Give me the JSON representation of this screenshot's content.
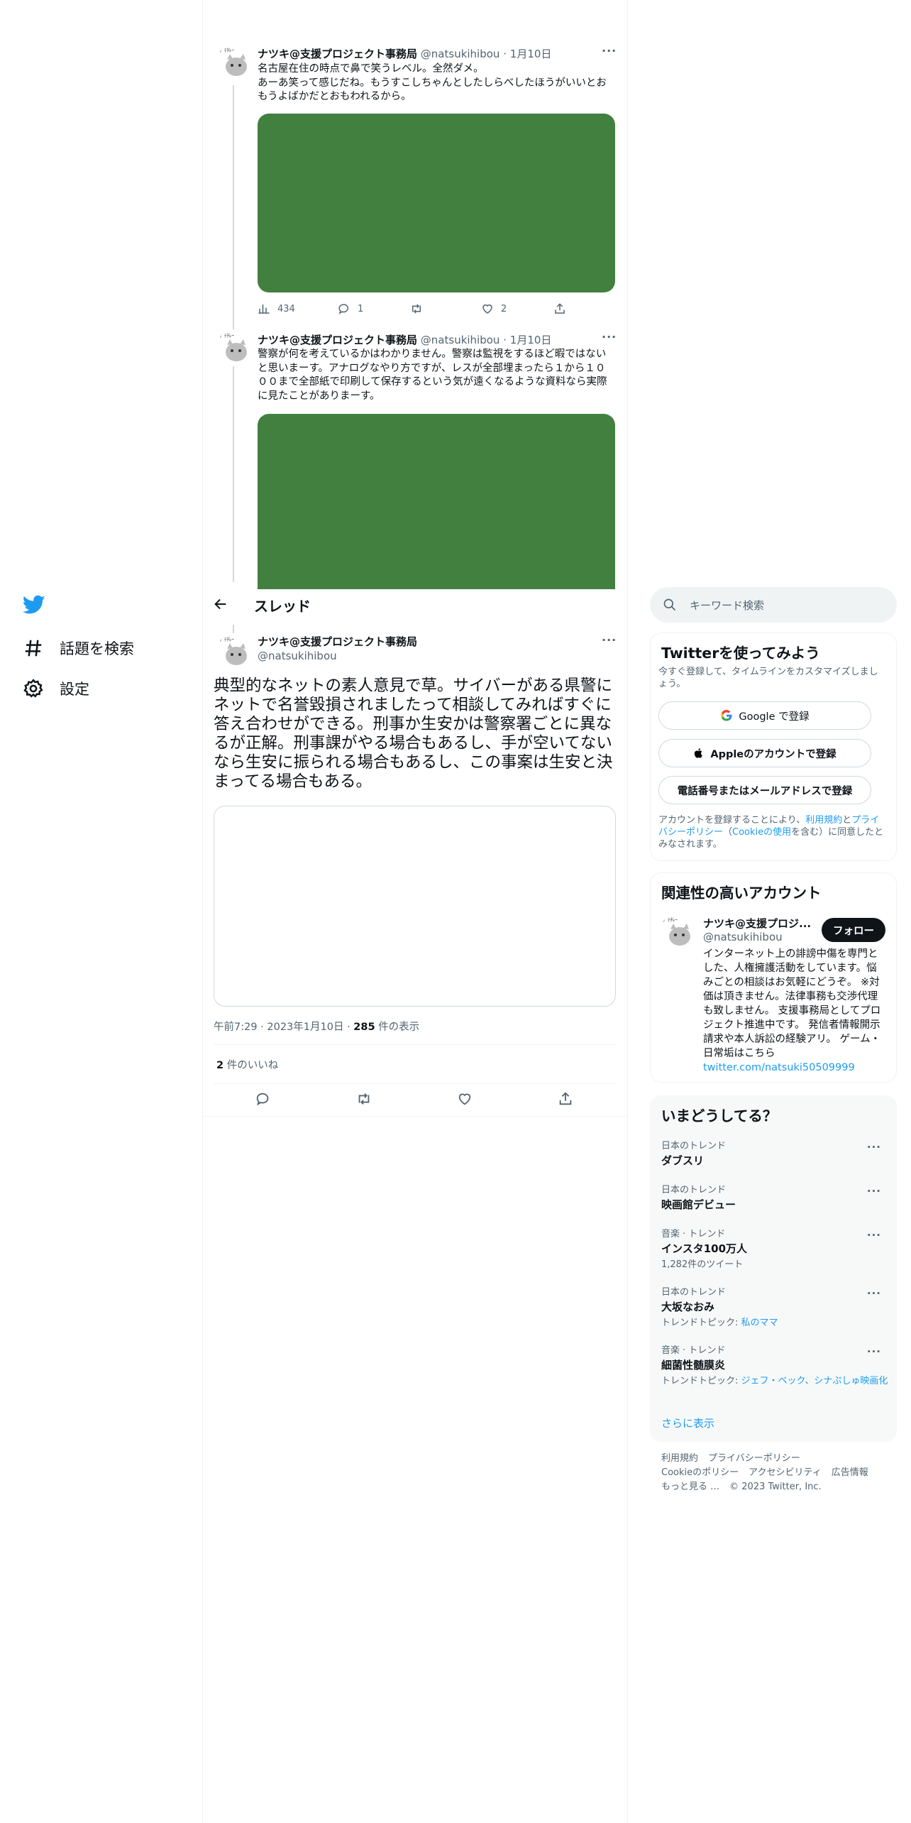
{
  "nav": {
    "items": [
      {
        "label": "話題を検索",
        "icon": "hashtag-icon"
      },
      {
        "label": "設定",
        "icon": "gear-icon"
      }
    ]
  },
  "header": {
    "title": "スレッド"
  },
  "tweet1": {
    "name": "ナツキ@支援プロジェクト事務局",
    "handle": "@natsukihibou",
    "sep": "·",
    "date": "1月10日",
    "line1": "名古屋在住の時点で鼻で笑うレベル。全然ダメ。",
    "line2": "あーあ笑って感じだね。もうすこしちゃんとしたしらべしたほうがいいとおもうよばかだとおもわれるから。",
    "views": "434",
    "replies": "1",
    "retweets": "",
    "likes": "2"
  },
  "tweet2": {
    "name": "ナツキ@支援プロジェクト事務局",
    "handle": "@natsukihibou",
    "sep": "·",
    "date": "1月10日",
    "text": "警察が何を考えているかはわかりません。警察は監視をするほど暇ではないと思いまーす。アナログなやり方ですが、レスが全部埋まったら１から１０００まで全部紙で印刷して保存するという気が遠くなるような資料なら実際に見たことがありまーす。"
  },
  "main_tweet": {
    "name": "ナツキ@支援プロジェクト事務局",
    "handle": "@natsukihibou",
    "text": "典型的なネットの素人意見で草。サイバーがある県警にネットで名誉毀損されましたって相談してみればすぐに答え合わせができる。刑事か生安かは警察署ごとに異なるが正解。刑事課がやる場合もあるし、手が空いてないなら生安に振られる場合もあるし、この事案は生安と決まってる場合もある。",
    "time": "午前7:29",
    "date": "2023年1月10日",
    "views_count": "285",
    "views_label": "件の表示",
    "likes_count": "2",
    "likes_label": "件のいいね"
  },
  "search": {
    "placeholder": "キーワード検索"
  },
  "signup": {
    "title": "Twitterを使ってみよう",
    "subtitle": "今すぐ登録して、タイムラインをカスタマイズしましょう。",
    "google": "Google で登録",
    "apple": "Appleのアカウントで登録",
    "phone": "電話番号またはメールアドレスで登録",
    "legal_pre": "アカウントを登録することにより、",
    "legal_terms": "利用規約",
    "legal_and": "と",
    "legal_privacy": "プライバシーポリシー",
    "legal_paren_open": "（",
    "legal_cookie": "Cookieの使用",
    "legal_post": "を含む）に同意したとみなされます。"
  },
  "related": {
    "title": "関連性の高いアカウント",
    "name": "ナツキ@支援プロジ...",
    "handle": "@natsukihibou",
    "follow": "フォロー",
    "bio": "インターネット上の誹謗中傷を専門とした、人権擁護活動をしています。悩みごとの相談はお気軽にどうぞ。 ※対価は頂きません。法律事務も交渉代理も致しません。 支援事務局としてプロジェクト推進中です。 発信者情報開示請求や本人訴訟の経験アリ。 ゲーム・日常垢はこちら",
    "link": "twitter.com/natsuki50509999"
  },
  "trends": {
    "title": "いまどうしてる？",
    "items": [
      {
        "context": "日本のトレンド",
        "name": "ダブスリ",
        "sub_label": "",
        "sub_link": ""
      },
      {
        "context": "日本のトレンド",
        "name": "映画館デビュー",
        "sub_label": "",
        "sub_link": ""
      },
      {
        "context": "音楽 · トレンド",
        "name": "インスタ100万人",
        "sub_label": "1,282件のツイート",
        "sub_link": ""
      },
      {
        "context": "日本のトレンド",
        "name": "大坂なおみ",
        "sub_label": "トレンドトピック: ",
        "sub_link": "私のママ"
      },
      {
        "context": "音楽 · トレンド",
        "name": "細菌性髄膜炎",
        "sub_label": "トレンドトピック: ",
        "sub_link": "ジェフ・ベック、シナぷしゅ映画化"
      }
    ],
    "show_more": "さらに表示"
  },
  "footer": {
    "terms": "利用規約",
    "privacy": "プライバシーポリシー",
    "cookie": "Cookieのポリシー",
    "accessibility": "アクセシビリティ",
    "ads": "広告情報",
    "more": "もっと見る …",
    "copyright": "© 2023 Twitter, Inc."
  },
  "colors": {
    "accent": "#1d9bf0",
    "media": "#41803f",
    "text": "#0f1419",
    "muted": "#536471"
  }
}
